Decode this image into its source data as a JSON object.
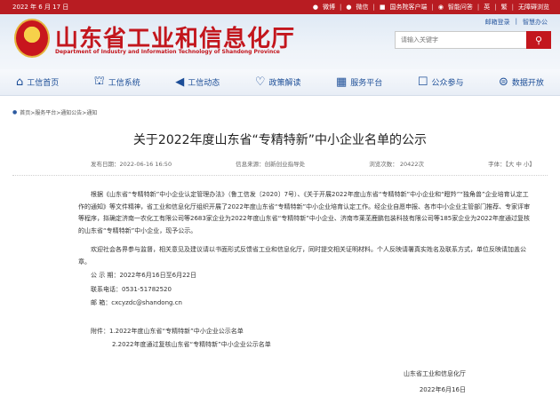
{
  "topbar": {
    "date": "2022 年 6 月 17 日",
    "links": [
      "微博",
      "微信",
      "国务院客户端",
      "智能问答",
      "英",
      "繁",
      "无障碍浏览"
    ]
  },
  "header": {
    "title": "山东省工业和信息化厅",
    "subtitle": "Department of Industry and Information Technology of Shandong Province",
    "login_links": [
      "邮箱登录",
      "智慧办公"
    ],
    "search_placeholder": "请输入关键字"
  },
  "nav": {
    "items": [
      {
        "label": "工信首页",
        "icon": "home-icon"
      },
      {
        "label": "工信系统",
        "icon": "building-icon"
      },
      {
        "label": "工信动态",
        "icon": "megaphone-icon"
      },
      {
        "label": "政策解读",
        "icon": "heart-icon"
      },
      {
        "label": "服务平台",
        "icon": "grid-icon"
      },
      {
        "label": "公众参与",
        "icon": "chat-icon"
      },
      {
        "label": "数据开放",
        "icon": "database-icon"
      }
    ]
  },
  "breadcrumb": "首页>服务平台>通知公告>通知",
  "article": {
    "title": "关于2022年度山东省“专精特新”中小企业名单的公示",
    "publish_date": "发布日期：2022-06-16 16:50",
    "source": "信息来源：创新创业指导处",
    "views": "浏览次数：   20422次",
    "font_size": "字体：【大 中 小】",
    "paragraph1": "根据《山东省“专精特新”中小企业认定管理办法》（鲁工信发〔2020〕7号）、《关于开展2022年度山东省“专精特新”中小企业和“瞪羚”“独角兽”企业培育认定工作的通知》等文件精神，省工业和信息化厅组织开展了2022年度山东省“专精特新”中小企业培育认定工作。经企业自愿申报、各市中小企业主管部门推荐、专家评审等程序，拟确定济南一农化工有限公司等2683家企业为2022年度山东省“专精特新”中小企业、济南市莱芜鹿鹏包装科技有限公司等185家企业为2022年度通过复核的山东省“专精特新”中小企业，现予公示。",
    "paragraph2": "欢迎社会各界参与监督，相关意见及建议请以书面形式反馈省工业和信息化厅，同时提交相关证明材料。个人反映请署真实姓名及联系方式，单位反映请加盖公章。",
    "period": "公 示 期：2022年6月16日至6月22日",
    "phone": "联系电话：0531-51782520",
    "email": "邮    箱：cxcyzdc@shandong.cn",
    "attachment1": "附件：1.2022年度山东省“专精特新”中小企业公示名单",
    "attachment2": "2.2022年度通过复核山东省“专精特新”中小企业公示名单",
    "signature": "山东省工业和信息化厅",
    "sign_date": "2022年6月16日"
  },
  "colors": {
    "brand_red": "#c3161d",
    "nav_blue": "#1b4d97"
  }
}
